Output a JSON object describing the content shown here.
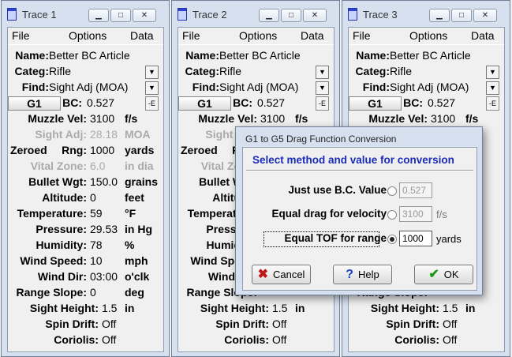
{
  "windows": [
    {
      "title": "Trace 1",
      "menu": [
        "File",
        "Options",
        "Data"
      ],
      "name": "Better BC Article",
      "categ": "Rifle",
      "find": "Sight Adj (MOA)",
      "g_button": "G1",
      "bc": "0.527",
      "muzzle_vel": "3100",
      "muzzle_unit": "f/s",
      "sight_adj": "28.18",
      "sight_adj_unit": "MOA",
      "zeroed_rng": "1000",
      "zeroed_unit": "yards",
      "vital_zone": "6.0",
      "vital_unit": "in dia",
      "bullet_wgt": "150.0",
      "bullet_unit": "grains",
      "altitude": "0",
      "altitude_unit": "feet",
      "temperature": "59",
      "temp_unit": "°F",
      "pressure": "29.53",
      "pressure_unit": "in Hg",
      "humidity": "78",
      "humidity_unit": "%",
      "wind_speed": "10",
      "wind_unit": "mph",
      "wind_dir": "03:00",
      "wind_dir_unit": "o'clk",
      "range_slope": "0",
      "slope_unit": "deg",
      "sight_height": "1.5",
      "sight_height_unit": "in",
      "spin_drift": "Off",
      "coriolis": "Off"
    },
    {
      "title": "Trace 2",
      "menu": [
        "File",
        "Options",
        "Data"
      ],
      "name": "Better BC Article",
      "categ": "Rifle",
      "find": "Sight Adj (MOA)",
      "g_button": "G1",
      "bc": "0.527",
      "muzzle_vel": "3100",
      "muzzle_unit": "f/s",
      "sight_adj": "",
      "sight_adj_unit": "",
      "zeroed_rng": "",
      "zeroed_unit": "",
      "vital_zone": "",
      "vital_unit": "",
      "bullet_wgt": "",
      "bullet_unit": "",
      "altitude": "",
      "altitude_unit": "",
      "temperature": "",
      "temp_unit": "",
      "pressure": "",
      "pressure_unit": "",
      "humidity": "",
      "humidity_unit": "",
      "wind_speed": "",
      "wind_unit": "",
      "wind_dir": "",
      "wind_dir_unit": "",
      "range_slope": "",
      "slope_unit": "",
      "sight_height": "1.5",
      "sight_height_unit": "in",
      "spin_drift": "Off",
      "coriolis": "Off"
    },
    {
      "title": "Trace 3",
      "menu": [
        "File",
        "Options",
        "Data"
      ],
      "name": "Better BC Article",
      "categ": "Rifle",
      "find": "Sight Adj (MOA)",
      "g_button": "G1",
      "bc": "0.527",
      "muzzle_vel": "3100",
      "muzzle_unit": "f/s",
      "sight_adj": "",
      "sight_adj_unit": "",
      "zeroed_rng": "",
      "zeroed_unit": "",
      "vital_zone": "",
      "vital_unit": "",
      "bullet_wgt": "",
      "bullet_unit": "",
      "altitude": "",
      "altitude_unit": "",
      "temperature": "",
      "temp_unit": "",
      "pressure": "",
      "pressure_unit": "",
      "humidity": "",
      "humidity_unit": "",
      "wind_speed": "",
      "wind_unit": "",
      "wind_dir": "",
      "wind_dir_unit": "",
      "range_slope": "",
      "slope_unit": "",
      "sight_height": "1.5",
      "sight_height_unit": "in",
      "spin_drift": "Off",
      "coriolis": "Off"
    }
  ],
  "labels": {
    "name": "Name:",
    "categ": "Categ:",
    "find": "Find:",
    "bc": "BC:",
    "muzzle_vel": "Muzzle Vel:",
    "sight_adj": "Sight Adj:",
    "zeroed": "Zeroed",
    "rng": "Rng:",
    "vital_zone": "Vital Zone:",
    "bullet_wgt": "Bullet Wgt:",
    "altitude": "Altitude:",
    "temperature": "Temperature:",
    "pressure": "Pressure:",
    "humidity": "Humidity:",
    "wind_speed": "Wind Speed:",
    "wind_dir": "Wind Dir:",
    "range_slope": "Range Slope:",
    "sight_height": "Sight Height:",
    "spin_drift": "Spin Drift:",
    "coriolis": "Coriolis:"
  },
  "dialog": {
    "title": "G1 to G5 Drag Function Conversion",
    "heading": "Select method and value for conversion",
    "options": [
      {
        "label": "Just use B.C. Value",
        "value": "0.527",
        "unit": "",
        "selected": false
      },
      {
        "label": "Equal drag for velocity",
        "value": "3100",
        "unit": "f/s",
        "selected": false
      },
      {
        "label": "Equal TOF for range",
        "value": "1000",
        "unit": "yards",
        "selected": true
      }
    ],
    "buttons": {
      "cancel": "Cancel",
      "help": "Help",
      "ok": "OK"
    }
  }
}
